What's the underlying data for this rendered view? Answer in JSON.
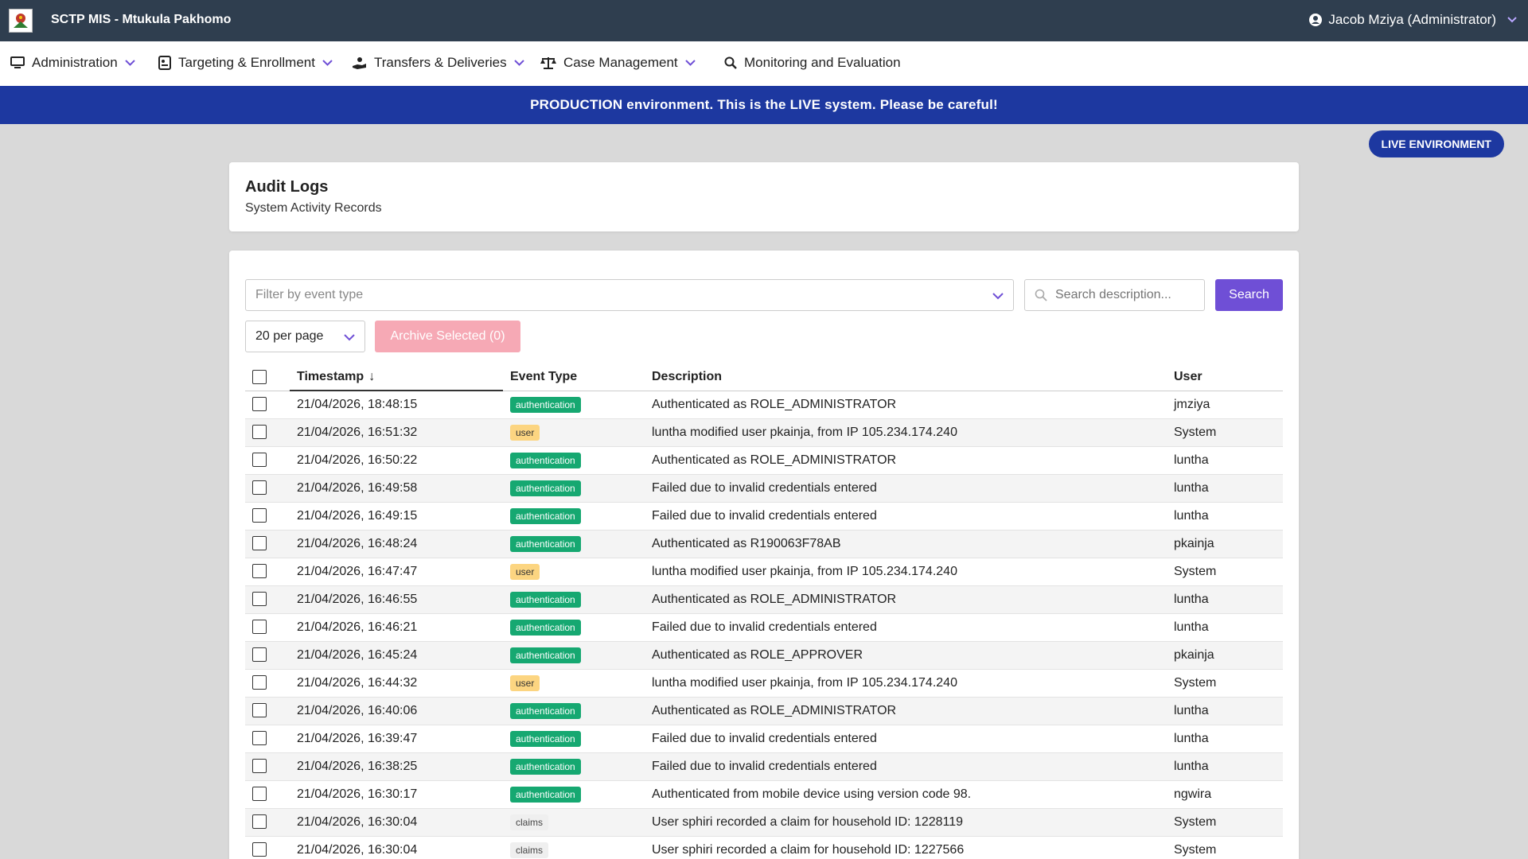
{
  "topbar": {
    "app_title": "SCTP MIS - Mtukula Pakhomo",
    "user_label": "Jacob Mziya (Administrator)"
  },
  "nav": {
    "items": [
      {
        "label": "Administration",
        "icon": "monitor-icon",
        "has_dropdown": true
      },
      {
        "label": "Targeting & Enrollment",
        "icon": "id-card-icon",
        "has_dropdown": true
      },
      {
        "label": "Transfers & Deliveries",
        "icon": "hand-money-icon",
        "has_dropdown": true
      },
      {
        "label": "Case Management",
        "icon": "scale-icon",
        "has_dropdown": true
      },
      {
        "label": "Monitoring and Evaluation",
        "icon": "search-icon",
        "has_dropdown": false
      }
    ]
  },
  "banner": {
    "text": "PRODUCTION environment. This is the LIVE system. Please be careful!"
  },
  "live_pill": "LIVE ENVIRONMENT",
  "page": {
    "title": "Audit Logs",
    "subtitle": "System Activity Records"
  },
  "filters": {
    "event_type_placeholder": "Filter by event type",
    "search_placeholder": "Search description...",
    "search_button": "Search",
    "per_page": "20 per page",
    "archive_button": "Archive Selected (0)"
  },
  "table": {
    "headers": {
      "timestamp": "Timestamp",
      "event_type": "Event Type",
      "description": "Description",
      "user": "User"
    },
    "rows": [
      {
        "timestamp": "21/04/2026, 18:48:15",
        "event_type": "authentication",
        "description": "Authenticated as ROLE_ADMINISTRATOR",
        "user": "jmziya"
      },
      {
        "timestamp": "21/04/2026, 16:51:32",
        "event_type": "user",
        "description": "luntha modified user pkainja, from IP 105.234.174.240",
        "user": "System"
      },
      {
        "timestamp": "21/04/2026, 16:50:22",
        "event_type": "authentication",
        "description": "Authenticated as ROLE_ADMINISTRATOR",
        "user": "luntha"
      },
      {
        "timestamp": "21/04/2026, 16:49:58",
        "event_type": "authentication",
        "description": "Failed due to invalid credentials entered",
        "user": "luntha"
      },
      {
        "timestamp": "21/04/2026, 16:49:15",
        "event_type": "authentication",
        "description": "Failed due to invalid credentials entered",
        "user": "luntha"
      },
      {
        "timestamp": "21/04/2026, 16:48:24",
        "event_type": "authentication",
        "description": "Authenticated as R190063F78AB",
        "user": "pkainja"
      },
      {
        "timestamp": "21/04/2026, 16:47:47",
        "event_type": "user",
        "description": "luntha modified user pkainja, from IP 105.234.174.240",
        "user": "System"
      },
      {
        "timestamp": "21/04/2026, 16:46:55",
        "event_type": "authentication",
        "description": "Authenticated as ROLE_ADMINISTRATOR",
        "user": "luntha"
      },
      {
        "timestamp": "21/04/2026, 16:46:21",
        "event_type": "authentication",
        "description": "Failed due to invalid credentials entered",
        "user": "luntha"
      },
      {
        "timestamp": "21/04/2026, 16:45:24",
        "event_type": "authentication",
        "description": "Authenticated as ROLE_APPROVER",
        "user": "pkainja"
      },
      {
        "timestamp": "21/04/2026, 16:44:32",
        "event_type": "user",
        "description": "luntha modified user pkainja, from IP 105.234.174.240",
        "user": "System"
      },
      {
        "timestamp": "21/04/2026, 16:40:06",
        "event_type": "authentication",
        "description": "Authenticated as ROLE_ADMINISTRATOR",
        "user": "luntha"
      },
      {
        "timestamp": "21/04/2026, 16:39:47",
        "event_type": "authentication",
        "description": "Failed due to invalid credentials entered",
        "user": "luntha"
      },
      {
        "timestamp": "21/04/2026, 16:38:25",
        "event_type": "authentication",
        "description": "Failed due to invalid credentials entered",
        "user": "luntha"
      },
      {
        "timestamp": "21/04/2026, 16:30:17",
        "event_type": "authentication",
        "description": "Authenticated from mobile device using version code 98.",
        "user": "ngwira"
      },
      {
        "timestamp": "21/04/2026, 16:30:04",
        "event_type": "claims",
        "description": "User sphiri recorded a claim for household ID: 1228119",
        "user": "System"
      },
      {
        "timestamp": "21/04/2026, 16:30:04",
        "event_type": "claims",
        "description": "User sphiri recorded a claim for household ID: 1227566",
        "user": "System"
      }
    ]
  },
  "colors": {
    "topbar": "#2f3e4f",
    "banner": "#1d38a0",
    "accent": "#6f4fd6",
    "auth_badge": "#16a871",
    "user_badge": "#fcd581",
    "claims_badge": "#efefef"
  }
}
